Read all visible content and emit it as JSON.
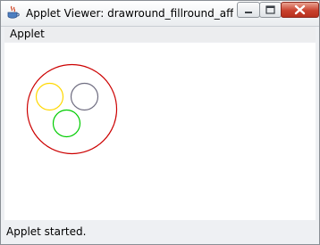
{
  "window": {
    "title": "Applet Viewer: drawround_fillround_affline...",
    "icon": "java-coffee-cup-icon",
    "controls": [
      "minimize",
      "maximize",
      "close"
    ],
    "close_color": "#c9422e"
  },
  "menu": {
    "label": "Applet"
  },
  "canvas": {
    "background": "#ffffff",
    "shapes": [
      {
        "name": "outer-circle",
        "color": "#cc0000"
      },
      {
        "name": "yellow-circle",
        "color": "#ffd800"
      },
      {
        "name": "gray-circle",
        "color": "#6e6c80"
      },
      {
        "name": "green-circle",
        "color": "#00cc00"
      }
    ]
  },
  "status": {
    "text": "Applet started."
  }
}
